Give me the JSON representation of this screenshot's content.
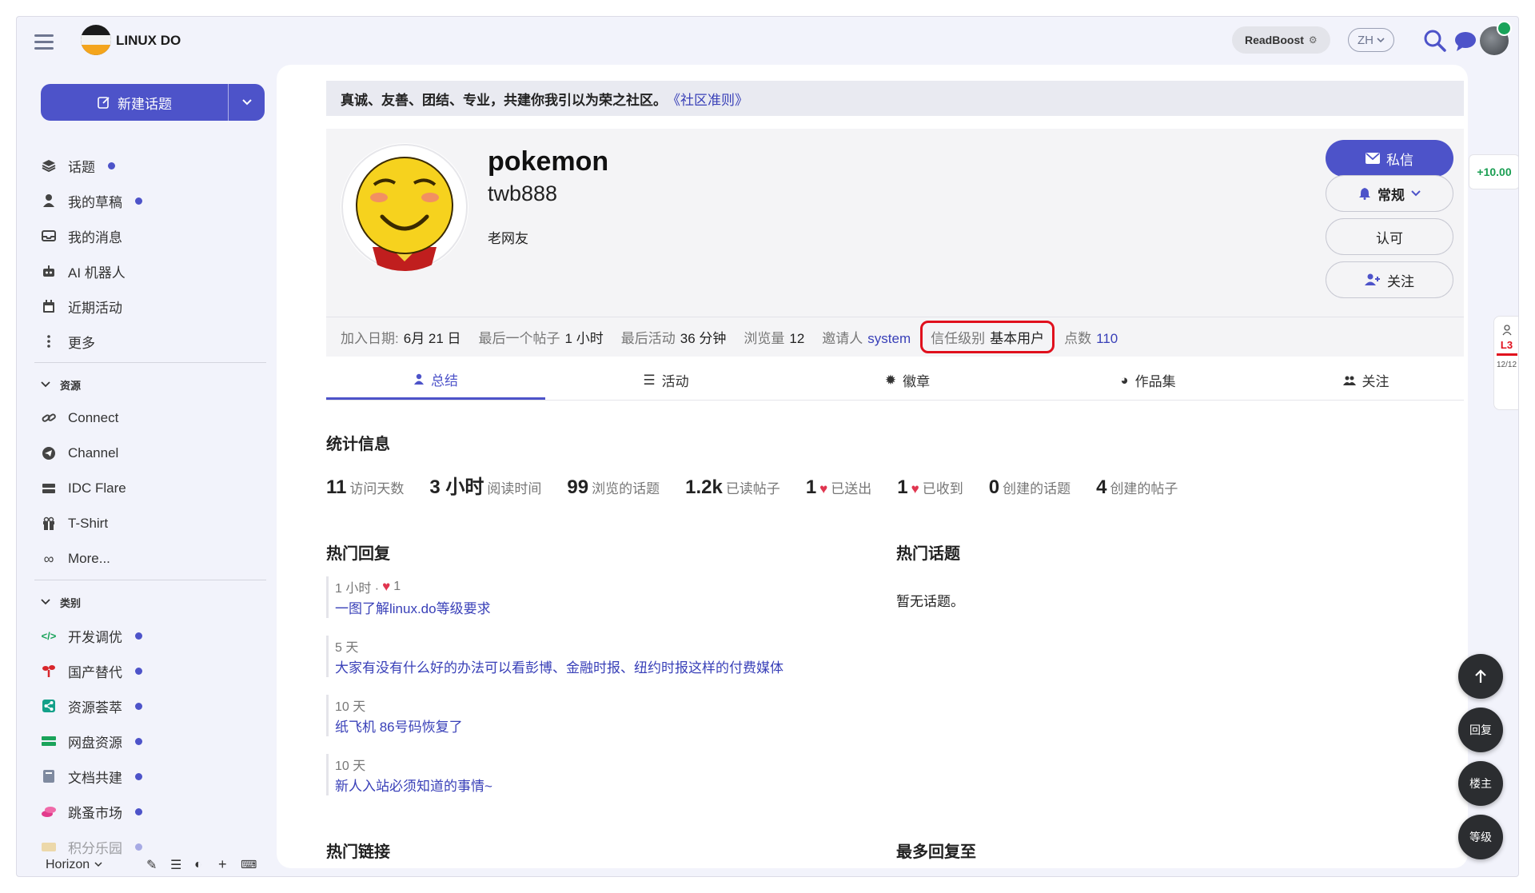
{
  "site": {
    "name": "LINUX DO",
    "readboost": "ReadBoost",
    "lang": "ZH"
  },
  "sidebar": {
    "new_topic": "新建话题",
    "items": [
      {
        "label": "话题",
        "dot": true
      },
      {
        "label": "我的草稿",
        "dot": true
      },
      {
        "label": "我的消息",
        "dot": false
      },
      {
        "label": "AI 机器人",
        "dot": false
      },
      {
        "label": "近期活动",
        "dot": false
      },
      {
        "label": "更多",
        "dot": false
      }
    ],
    "resources_header": "资源",
    "resources": [
      "Connect",
      "Channel",
      "IDC Flare",
      "T-Shirt",
      "More..."
    ],
    "categories_header": "类别",
    "categories": [
      {
        "label": "开发调优",
        "color": "#1aa35a"
      },
      {
        "label": "国产替代",
        "color": "#d8252b"
      },
      {
        "label": "资源荟萃",
        "color": "#12a089"
      },
      {
        "label": "网盘资源",
        "color": "#1aa35a"
      },
      {
        "label": "文档共建",
        "color": "#7f8aa0"
      },
      {
        "label": "跳蚤市场",
        "color": "#e23b8c"
      },
      {
        "label": "积分乐园",
        "color": "#e6b84a"
      }
    ],
    "theme": "Horizon"
  },
  "banner": {
    "text": "真诚、友善、团结、专业，共建你我引以为荣之社区。",
    "link": "《社区准则》"
  },
  "profile": {
    "name": "pokemon",
    "handle": "twb888",
    "title": "老网友",
    "buttons": {
      "message": "私信",
      "notify": "常规",
      "endorse": "认可",
      "follow": "关注"
    },
    "meta": {
      "joined_label": "加入日期:",
      "joined": "6月 21 日",
      "last_post_label": "最后一个帖子",
      "last_post": "1 小时",
      "last_activity_label": "最后活动",
      "last_activity": "36 分钟",
      "views_label": "浏览量",
      "views": "12",
      "invited_label": "邀请人",
      "invited_by": "system",
      "trust_label": "信任级别",
      "trust": "基本用户",
      "points_label": "点数",
      "points": "110"
    }
  },
  "tabs": [
    "总结",
    "活动",
    "徽章",
    "作品集",
    "关注"
  ],
  "stats_title": "统计信息",
  "stats": [
    {
      "value": "11",
      "label": "访问天数"
    },
    {
      "value": "3 小时",
      "label": "阅读时间"
    },
    {
      "value": "99",
      "label": "浏览的话题"
    },
    {
      "value": "1.2k",
      "label": "已读帖子"
    },
    {
      "value": "1",
      "label": "已送出",
      "heart": true
    },
    {
      "value": "1",
      "label": "已收到",
      "heart": true
    },
    {
      "value": "0",
      "label": "创建的话题"
    },
    {
      "value": "4",
      "label": "创建的帖子"
    }
  ],
  "top_replies_title": "热门回复",
  "top_replies": [
    {
      "when": "1 小时 ·",
      "likes": "1",
      "title": "一图了解linux.do等级要求"
    },
    {
      "when": "5 天",
      "likes": "",
      "title": "大家有没有什么好的办法可以看彭博、金融时报、纽约时报这样的付费媒体"
    },
    {
      "when": "10 天",
      "likes": "",
      "title": "纸飞机 86号码恢复了"
    },
    {
      "when": "10 天",
      "likes": "",
      "title": "新人入站必须知道的事情~"
    }
  ],
  "top_topics_title": "热门话题",
  "top_topics_empty": "暂无话题。",
  "top_links_title": "热门链接",
  "most_replied_title": "最多回复至",
  "fab": {
    "reply": "回复",
    "owner": "楼主",
    "level": "等级"
  },
  "side_widgets": {
    "points_delta": "+10.00",
    "level": "L3",
    "level_progress": "12/12"
  },
  "colors": {
    "accent": "#4d53c9",
    "link": "#3940b8",
    "highlight": "#e0101d"
  }
}
